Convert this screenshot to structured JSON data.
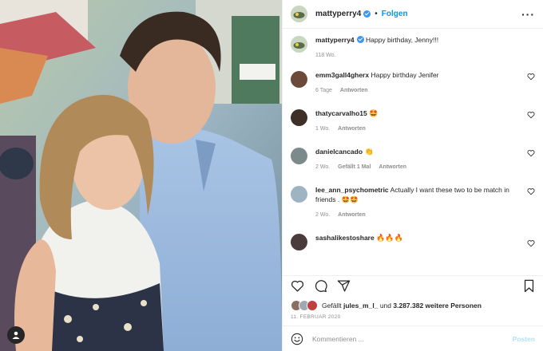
{
  "header": {
    "username": "mattyperry4",
    "separator": "•",
    "follow_label": "Folgen",
    "more_label": "···"
  },
  "caption": {
    "username": "mattyperry4",
    "text": "Happy birthday, Jenny!!!",
    "time": "118 Wo."
  },
  "comments": [
    {
      "username": "emm3gall4gherx",
      "text": "Happy birthday Jenifer",
      "time": "6 Tage",
      "likes": "",
      "reply": "Antworten",
      "avatar_color": "#6b4a3a"
    },
    {
      "username": "thatycarvalho15",
      "text": "🤩",
      "time": "1 Wo.",
      "likes": "",
      "reply": "Antworten",
      "avatar_color": "#3e3028"
    },
    {
      "username": "danielcancado",
      "text": "👏",
      "time": "2 Wo.",
      "likes": "Gefällt 1 Mal",
      "reply": "Antworten",
      "avatar_color": "#7c8a8c"
    },
    {
      "username": "lee_ann_psychometric",
      "text": "Actually I want these two to be match in friends . 🤩🤩",
      "time": "2 Wo.",
      "likes": "",
      "reply": "Antworten",
      "avatar_color": "#9fb4c2"
    },
    {
      "username": "sashalikestoshare",
      "text": "🔥🔥🔥",
      "time": "",
      "likes": "",
      "reply": "",
      "avatar_color": "#4a3c3c"
    }
  ],
  "likes": {
    "prefix": "Gefällt",
    "user": "jules_m_l_",
    "middle": "und",
    "count": "3.287.382 weitere Personen"
  },
  "date": "11. FEBRUAR 2020",
  "add_comment": {
    "placeholder": "Kommentieren ...",
    "post_label": "Posten"
  },
  "icons": {
    "like": "heart-icon",
    "comment": "comment-icon",
    "share": "paper-plane-icon",
    "save": "bookmark-icon",
    "emoji": "smiley-icon",
    "tag": "user-tag-icon"
  },
  "colors": {
    "accent": "#0095f6",
    "verified": "#3897f0",
    "muted": "#8e8e8e"
  }
}
